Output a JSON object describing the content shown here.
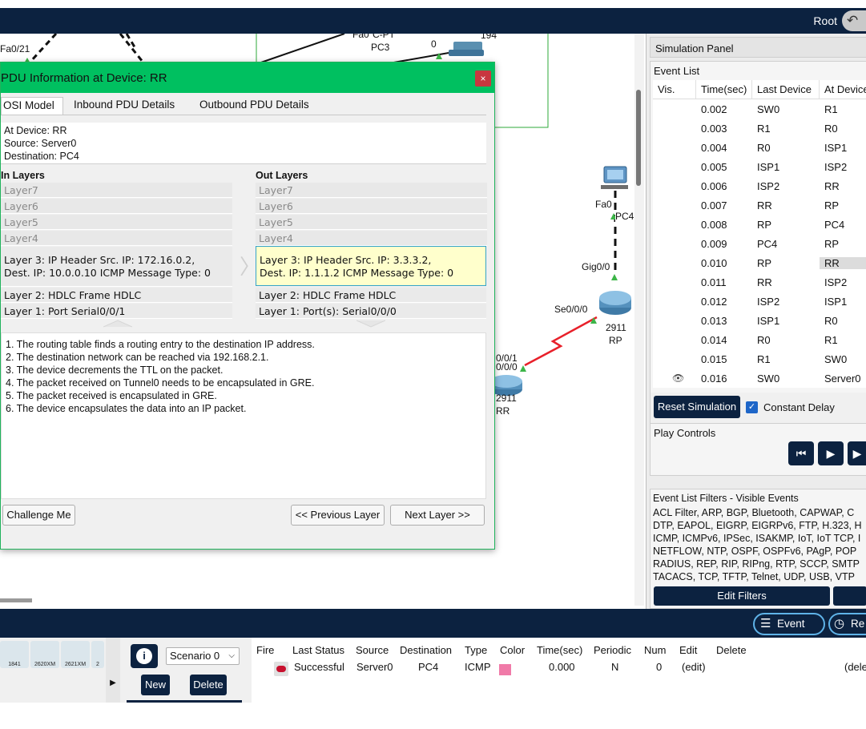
{
  "topbar": {
    "root_label": "Root",
    "back_icon": "undo-arrow-icon"
  },
  "workspace": {
    "labels": {
      "fa021": "Fa0/21",
      "fa0_top": "Fa0",
      "cpt": "C-PT",
      "pc3": "PC3",
      "zero": "0",
      "n194": "194",
      "fa0_pc4": "Fa0",
      "pc4": "PC4",
      "gig00": "Gig0/0",
      "se000": "Se0/0/0",
      "m2911_rp": "2911",
      "rp": "RP",
      "s001": "0/0/1",
      "s000b": "0/0/0",
      "m2911_rr": "2911",
      "rr": "RR"
    }
  },
  "pdu_dialog": {
    "title": "PDU Information at Device: RR",
    "close_label": "×",
    "tabs": [
      "OSI Model",
      "Inbound PDU Details",
      "Outbound PDU Details"
    ],
    "info": {
      "device": "At Device: RR",
      "source": "Source: Server0",
      "destination": "Destination: PC4"
    },
    "in_title": "In Layers",
    "out_title": "Out Layers",
    "in_layers": {
      "l7": "Layer7",
      "l6": "Layer6",
      "l5": "Layer5",
      "l4": "Layer4",
      "l3a": "Layer 3: IP Header Src. IP: 172.16.0.2,",
      "l3b": "Dest. IP: 10.0.0.10 ICMP Message Type: 0",
      "l2": "Layer 2: HDLC Frame HDLC",
      "l1": "Layer 1: Port Serial0/0/1"
    },
    "out_layers": {
      "l7": "Layer7",
      "l6": "Layer6",
      "l5": "Layer5",
      "l4": "Layer4",
      "l3a": "Layer 3: IP Header Src. IP: 3.3.3.2,",
      "l3b": "Dest. IP: 1.1.1.2 ICMP Message Type: 0",
      "l2": "Layer 2: HDLC Frame HDLC",
      "l1": "Layer 1: Port(s): Serial0/0/0"
    },
    "steps": [
      "1. The routing table finds a routing entry to the destination IP address.",
      "2. The destination network can be reached via 192.168.2.1.",
      "3. The device decrements the TTL on the packet.",
      "4. The packet received on Tunnel0 needs to be encapsulated in GRE.",
      "5. The packet received is encapsulated in GRE.",
      "6. The device encapsulates the data into an IP packet."
    ],
    "challenge_label": "Challenge Me",
    "prev_label": "<< Previous Layer",
    "next_label": "Next Layer >>"
  },
  "sim_panel": {
    "title": "Simulation Panel",
    "event_list_title": "Event List",
    "columns": [
      "Vis.",
      "Time(sec)",
      "Last Device",
      "At Device"
    ],
    "events": [
      {
        "time": "0.002",
        "last": "SW0",
        "at": "R1"
      },
      {
        "time": "0.003",
        "last": "R1",
        "at": "R0"
      },
      {
        "time": "0.004",
        "last": "R0",
        "at": "ISP1"
      },
      {
        "time": "0.005",
        "last": "ISP1",
        "at": "ISP2"
      },
      {
        "time": "0.006",
        "last": "ISP2",
        "at": "RR"
      },
      {
        "time": "0.007",
        "last": "RR",
        "at": "RP"
      },
      {
        "time": "0.008",
        "last": "RP",
        "at": "PC4"
      },
      {
        "time": "0.009",
        "last": "PC4",
        "at": "RP"
      },
      {
        "time": "0.010",
        "last": "RP",
        "at": "RR"
      },
      {
        "time": "0.011",
        "last": "RR",
        "at": "ISP2"
      },
      {
        "time": "0.012",
        "last": "ISP2",
        "at": "ISP1"
      },
      {
        "time": "0.013",
        "last": "ISP1",
        "at": "R0"
      },
      {
        "time": "0.014",
        "last": "R0",
        "at": "R1"
      },
      {
        "time": "0.015",
        "last": "R1",
        "at": "SW0"
      },
      {
        "time": "0.016",
        "last": "SW0",
        "at": "Server0"
      }
    ],
    "reset_label": "Reset Simulation",
    "constant_delay_label": "Constant Delay",
    "play_controls_title": "Play Controls",
    "filters_title": "Event List Filters - Visible Events",
    "filter_lines": [
      "ACL Filter, ARP, BGP, Bluetooth, CAPWAP, C",
      "DTP, EAPOL, EIGRP, EIGRPv6, FTP, H.323, H",
      "ICMP, ICMPv6, IPSec, ISAKMP, IoT, IoT TCP, I",
      "NETFLOW, NTP, OSPF, OSPFv6, PAgP, POP",
      "RADIUS, REP, RIP, RIPng, RTP, SCCP, SMTP",
      "TACACS, TCP, TFTP, Telnet, UDP, USB, VTP"
    ],
    "edit_filters_label": "Edit Filters"
  },
  "bottom": {
    "event_list_tab": "Event List",
    "realtime_tab": "Re",
    "devices": [
      "1841",
      "2620XM",
      "2621XM",
      "2"
    ],
    "scenario_value": "Scenario 0",
    "new_label": "New",
    "delete_label": "Delete",
    "pdu_columns": [
      "Fire",
      "Last Status",
      "Source",
      "Destination",
      "Type",
      "Color",
      "Time(sec)",
      "Periodic",
      "Num",
      "Edit",
      "Delete"
    ],
    "pdu_row": {
      "status": "Successful",
      "source": "Server0",
      "destination": "PC4",
      "type": "ICMP",
      "color": "#f07aa8",
      "time": "0.000",
      "periodic": "N",
      "num": "0",
      "edit": "(edit)",
      "delete": "(dele"
    }
  },
  "colors": {
    "navy": "#0c2240",
    "dialog_green": "#00c060",
    "link_red": "#e8202a",
    "link_up": "#3cb548"
  }
}
